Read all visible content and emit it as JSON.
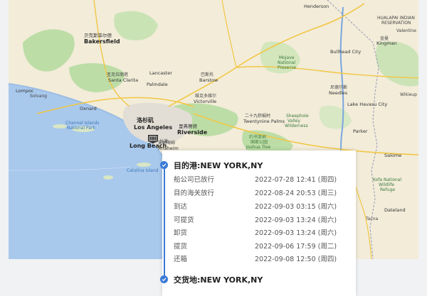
{
  "map": {
    "labels": [
      {
        "text": "Henderson",
        "cls": "city"
      },
      {
        "text": "HUALAPAI INDIAN",
        "cls": ""
      },
      {
        "text": "RESERVATION",
        "cls": ""
      },
      {
        "text": "Kingman",
        "cls": "city"
      },
      {
        "text": "金曼",
        "cls": ""
      },
      {
        "text": "Valentine",
        "cls": ""
      },
      {
        "text": "Bakersfield",
        "cls": "big"
      },
      {
        "text": "贝克斯菲尔德",
        "cls": "city"
      },
      {
        "text": "Barstow",
        "cls": "city"
      },
      {
        "text": "巴斯托",
        "cls": ""
      },
      {
        "text": "Mojave",
        "cls": "green"
      },
      {
        "text": "National",
        "cls": "green"
      },
      {
        "text": "Preserve",
        "cls": "green"
      },
      {
        "text": "Needles",
        "cls": "city"
      },
      {
        "text": "尼德尔斯",
        "cls": ""
      },
      {
        "text": "Lake Havasu City",
        "cls": "city"
      },
      {
        "text": "Victorville",
        "cls": "city"
      },
      {
        "text": "维克多维尔",
        "cls": ""
      },
      {
        "text": "Los Angeles",
        "cls": "big"
      },
      {
        "text": "洛杉矶",
        "cls": "big"
      },
      {
        "text": "Long Beach",
        "cls": "big"
      },
      {
        "text": "长滩",
        "cls": ""
      },
      {
        "text": "Riverside",
        "cls": "big"
      },
      {
        "text": "里弗赛德",
        "cls": "city"
      },
      {
        "text": "Anaheim",
        "cls": "city"
      },
      {
        "text": "安纳海姆",
        "cls": ""
      },
      {
        "text": "Twentynine Palms",
        "cls": "city"
      },
      {
        "text": "二十九棕榈村",
        "cls": ""
      },
      {
        "text": "Sheephole",
        "cls": "green"
      },
      {
        "text": "Valley",
        "cls": "green"
      },
      {
        "text": "Wilderness",
        "cls": "green"
      },
      {
        "text": "约书亚树",
        "cls": "green"
      },
      {
        "text": "国家公园",
        "cls": "green"
      },
      {
        "text": "Joshua Tree",
        "cls": "green"
      },
      {
        "text": "Kofa National",
        "cls": "green"
      },
      {
        "text": "Wildlife",
        "cls": "green"
      },
      {
        "text": "Refuge",
        "cls": "green"
      },
      {
        "text": "Parker",
        "cls": "city"
      },
      {
        "text": "Santa Clarita",
        "cls": "city"
      },
      {
        "text": "圣克拉丽塔",
        "cls": ""
      },
      {
        "text": "Oxnard",
        "cls": "city"
      },
      {
        "text": "Lompoc",
        "cls": "city"
      },
      {
        "text": "Solvang",
        "cls": ""
      },
      {
        "text": "Palmdale",
        "cls": "city"
      },
      {
        "text": "Lancaster",
        "cls": "city"
      },
      {
        "text": "Channel Islands",
        "cls": "blue"
      },
      {
        "text": "National Park",
        "cls": "blue"
      },
      {
        "text": "Catalina Island",
        "cls": "blue"
      },
      {
        "text": "Dateland",
        "cls": "city"
      },
      {
        "text": "Tacna",
        "cls": ""
      },
      {
        "text": "Salome",
        "cls": "city"
      },
      {
        "text": "Wikieup",
        "cls": ""
      },
      {
        "text": "Bullhead City",
        "cls": "city"
      }
    ]
  },
  "timeline": {
    "pod_title": "目的港:NEW YORK,NY",
    "events": [
      {
        "event": "船公司已放行",
        "time": "2022-07-28 12:41 (周四)"
      },
      {
        "event": "目的海关放行",
        "time": "2022-08-24 20:53 (周三)"
      },
      {
        "event": "到达",
        "time": "2022-09-03 03:15 (周六)"
      },
      {
        "event": "可提货",
        "time": "2022-09-03 13:24 (周六)"
      },
      {
        "event": "卸货",
        "time": "2022-09-03 13:24 (周六)"
      },
      {
        "event": "提货",
        "time": "2022-09-06 17:59 (周二)"
      },
      {
        "event": "还箱",
        "time": "2022-09-08 12:50 (周四)"
      }
    ],
    "delivery_title": "交货地:NEW YORK,NY"
  },
  "colors": {
    "accent": "#3a7ad6",
    "water": "#a8c8ec",
    "land": "#f2ecd9",
    "park": "#b7dca1"
  }
}
